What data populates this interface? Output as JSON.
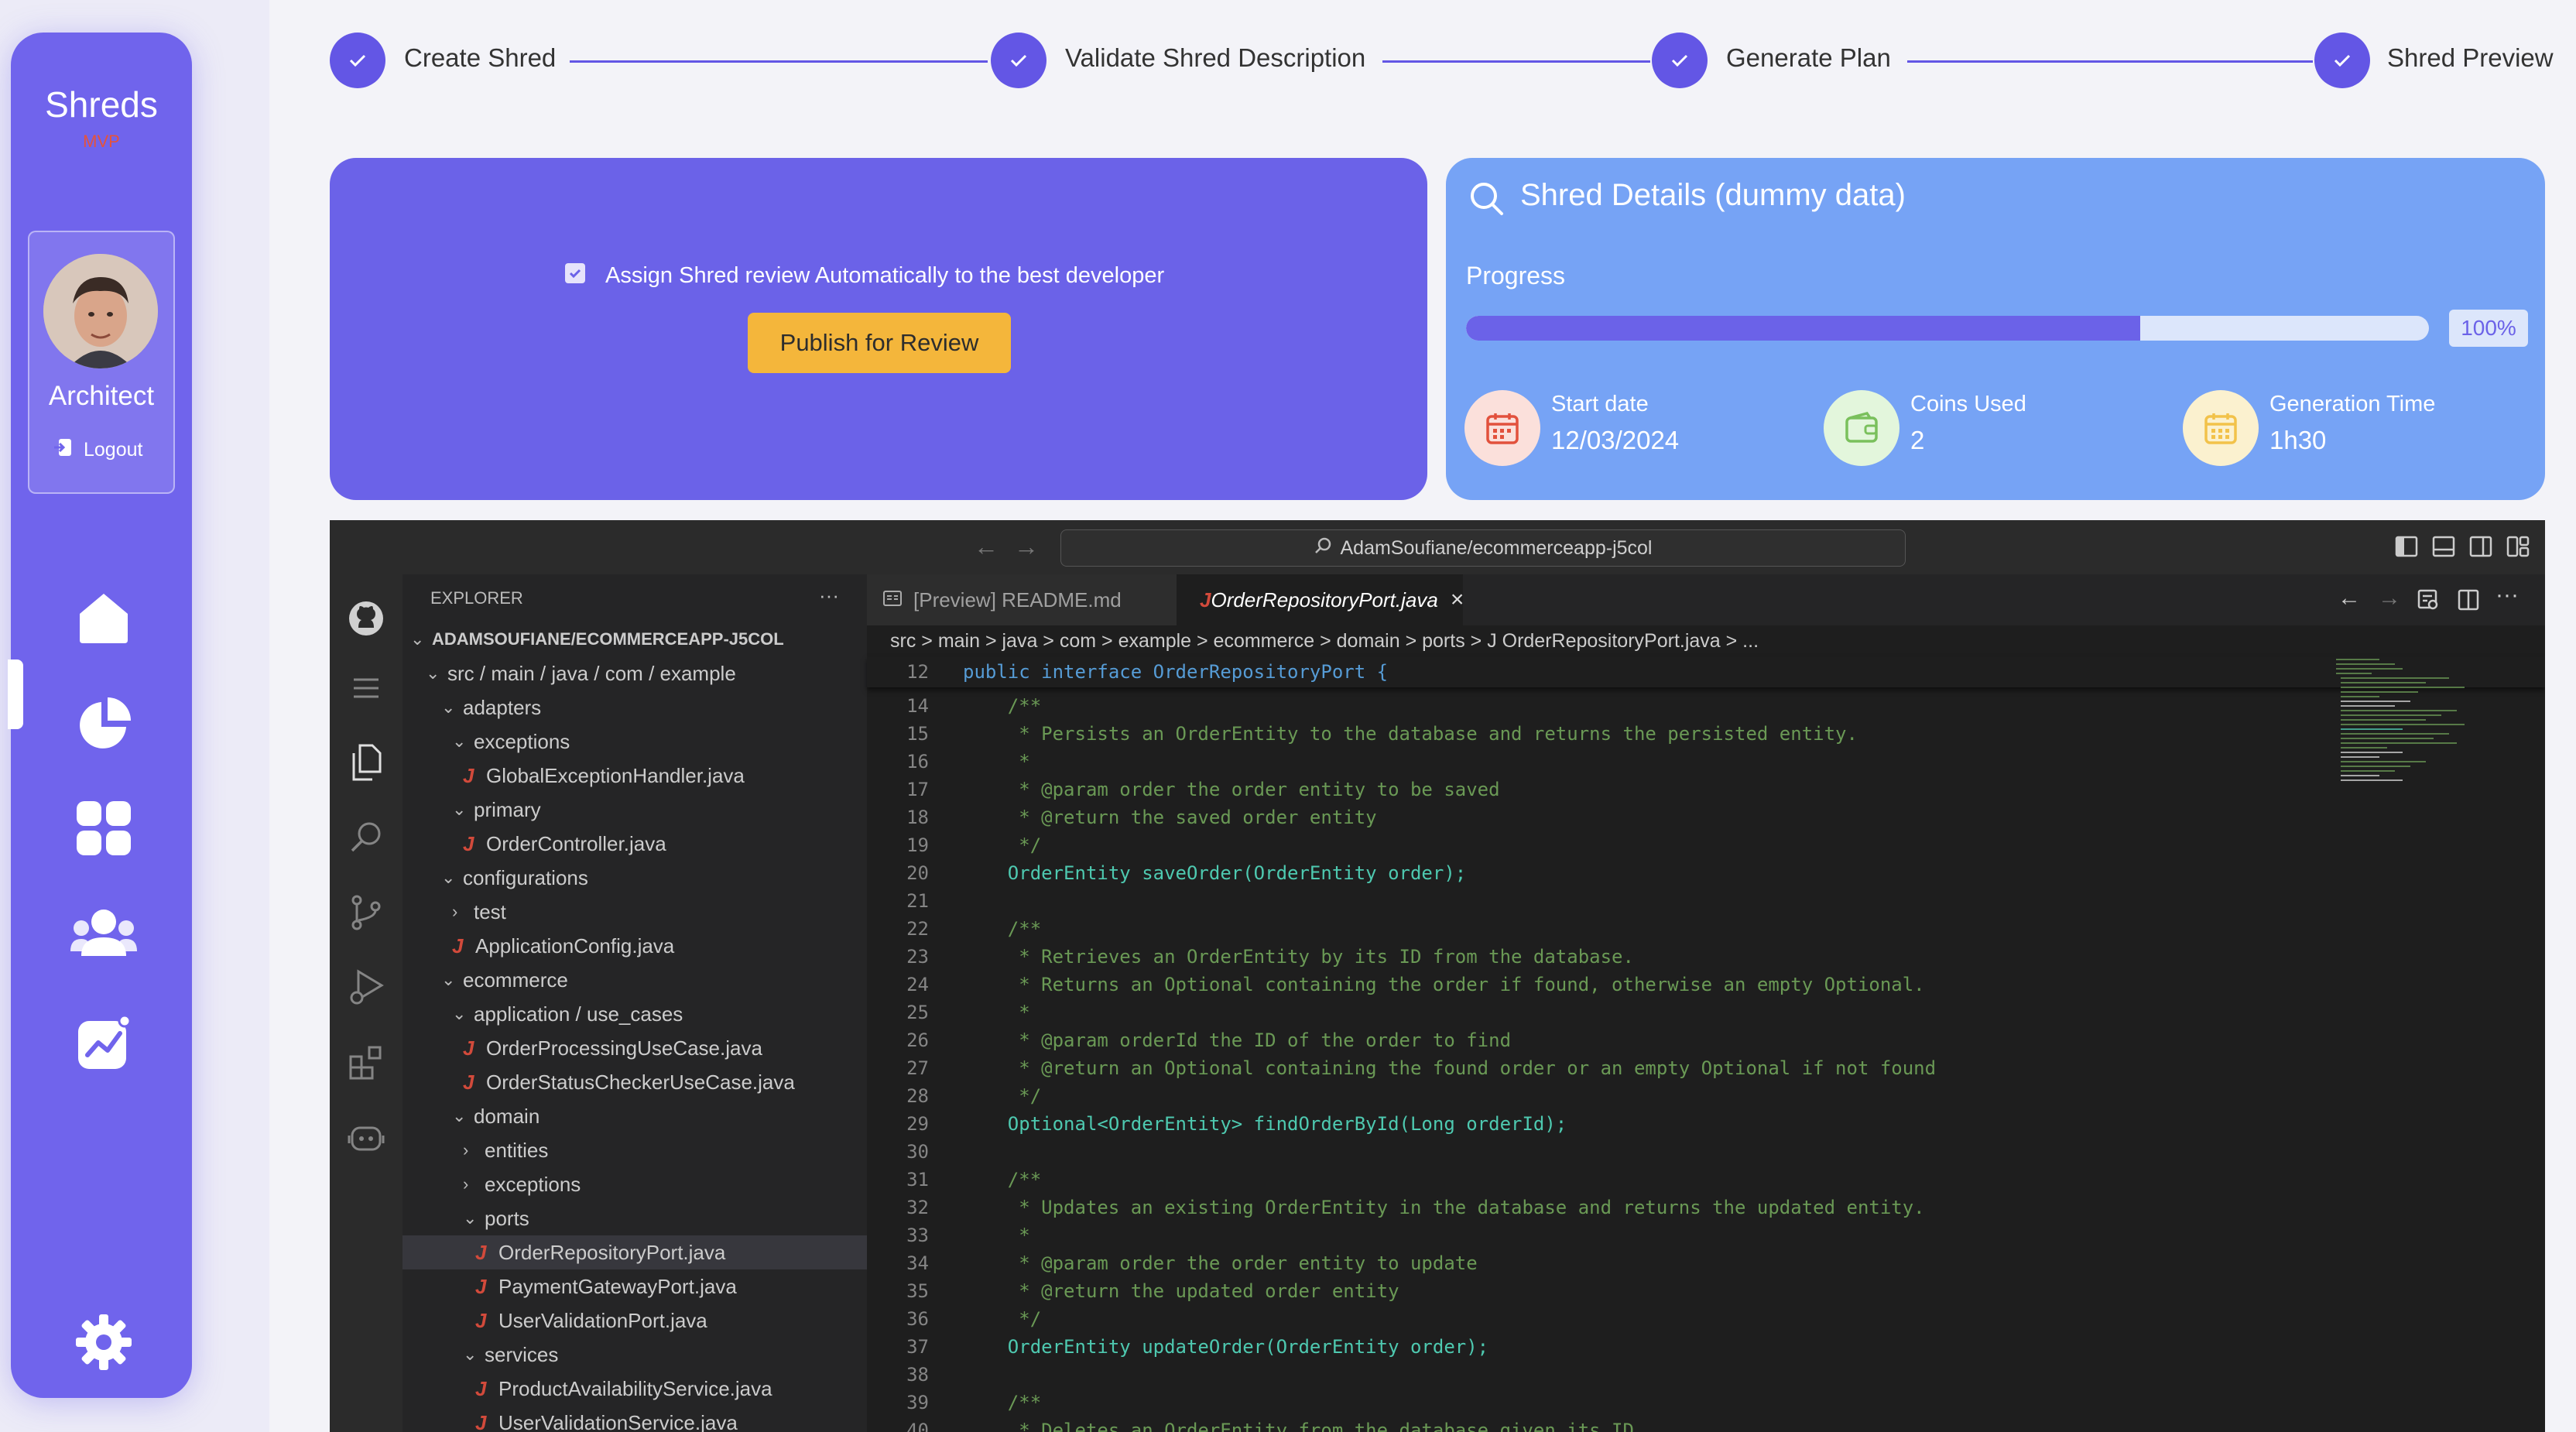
{
  "sidebar": {
    "brand": "Shreds",
    "brand_sub": "MVP",
    "role": "Architect",
    "logout_label": "Logout",
    "nav": [
      "home-icon",
      "pie-chart-icon",
      "apps-grid-icon",
      "users-icon",
      "analytics-icon",
      "settings-icon"
    ]
  },
  "stepper": {
    "steps": [
      "Create Shred",
      "Validate Shred Description",
      "Generate Plan",
      "Shred Preview"
    ]
  },
  "publish": {
    "checkbox_label": "Assign Shred review Automatically to the best developer",
    "checked": true,
    "button_label": "Publish for Review"
  },
  "details": {
    "title": "Shred Details (dummy data)",
    "progress_label": "Progress",
    "progress_badge": "100%",
    "progress_fill_fraction": 0.7,
    "stats": [
      {
        "label": "Start date",
        "value": "12/03/2024",
        "icon": "calendar-icon"
      },
      {
        "label": "Coins Used",
        "value": "2",
        "icon": "wallet-icon"
      },
      {
        "label": "Generation Time",
        "value": "1h30",
        "icon": "calendar-clock-icon"
      }
    ]
  },
  "ide": {
    "address": "AdamSoufiane/ecommerceapp-j5col",
    "explorer_title": "EXPLORER",
    "explorer_more": "···",
    "tree": [
      {
        "label": "ADAMSOUFIANE/ECOMMERCEAPP-J5COL",
        "kind": "root",
        "indent": 0
      },
      {
        "label": "src / main / java / com / example",
        "kind": "folder-open",
        "indent": 1
      },
      {
        "label": "adapters",
        "kind": "folder-open",
        "indent": 2
      },
      {
        "label": "exceptions",
        "kind": "folder-open",
        "indent": 3
      },
      {
        "label": "GlobalExceptionHandler.java",
        "kind": "java",
        "indent": 4
      },
      {
        "label": "primary",
        "kind": "folder-open",
        "indent": 3
      },
      {
        "label": "OrderController.java",
        "kind": "java",
        "indent": 4
      },
      {
        "label": "configurations",
        "kind": "folder-open",
        "indent": 2
      },
      {
        "label": "test",
        "kind": "folder-closed",
        "indent": 3
      },
      {
        "label": "ApplicationConfig.java",
        "kind": "java",
        "indent": 3
      },
      {
        "label": "ecommerce",
        "kind": "folder-open",
        "indent": 2
      },
      {
        "label": "application / use_cases",
        "kind": "folder-open",
        "indent": 3
      },
      {
        "label": "OrderProcessingUseCase.java",
        "kind": "java",
        "indent": 4
      },
      {
        "label": "OrderStatusCheckerUseCase.java",
        "kind": "java",
        "indent": 4
      },
      {
        "label": "domain",
        "kind": "folder-open",
        "indent": 3
      },
      {
        "label": "entities",
        "kind": "folder-closed",
        "indent": 4
      },
      {
        "label": "exceptions",
        "kind": "folder-closed",
        "indent": 4
      },
      {
        "label": "ports",
        "kind": "folder-open",
        "indent": 4
      },
      {
        "label": "OrderRepositoryPort.java",
        "kind": "java",
        "indent": 5,
        "selected": true
      },
      {
        "label": "PaymentGatewayPort.java",
        "kind": "java",
        "indent": 5
      },
      {
        "label": "UserValidationPort.java",
        "kind": "java",
        "indent": 5
      },
      {
        "label": "services",
        "kind": "folder-open",
        "indent": 4
      },
      {
        "label": "ProductAvailabilityService.java",
        "kind": "java",
        "indent": 5
      },
      {
        "label": "UserValidationService.java",
        "kind": "java",
        "indent": 5
      }
    ],
    "tabs": [
      {
        "label": "[Preview] README.md",
        "active": false
      },
      {
        "label": "OrderRepositoryPort.java",
        "active": true
      }
    ],
    "breadcrumb": "src  >  main  >  java  >  com  >  example  >  ecommerce  >  domain  >  ports  >  J  OrderRepositoryPort.java  >  ...",
    "sticky_line": {
      "n": "12",
      "text": "public interface OrderRepositoryPort {"
    },
    "code": [
      {
        "n": "14",
        "t": "    /**",
        "c": "cm"
      },
      {
        "n": "15",
        "t": "     * Persists an OrderEntity to the database and returns the persisted entity.",
        "c": "cm"
      },
      {
        "n": "16",
        "t": "     *",
        "c": "cm"
      },
      {
        "n": "17",
        "t": "     * @param order the order entity to be saved",
        "c": "cm"
      },
      {
        "n": "18",
        "t": "     * @return the saved order entity",
        "c": "cm"
      },
      {
        "n": "19",
        "t": "     */",
        "c": "cm"
      },
      {
        "n": "20",
        "t": "    OrderEntity saveOrder(OrderEntity order);",
        "c": "code"
      },
      {
        "n": "21",
        "t": "",
        "c": "pl"
      },
      {
        "n": "22",
        "t": "    /**",
        "c": "cm"
      },
      {
        "n": "23",
        "t": "     * Retrieves an OrderEntity by its ID from the database.",
        "c": "cm"
      },
      {
        "n": "24",
        "t": "     * Returns an Optional containing the order if found, otherwise an empty Optional.",
        "c": "cm"
      },
      {
        "n": "25",
        "t": "     *",
        "c": "cm"
      },
      {
        "n": "26",
        "t": "     * @param orderId the ID of the order to find",
        "c": "cm"
      },
      {
        "n": "27",
        "t": "     * @return an Optional containing the found order or an empty Optional if not found",
        "c": "cm"
      },
      {
        "n": "28",
        "t": "     */",
        "c": "cm"
      },
      {
        "n": "29",
        "t": "    Optional<OrderEntity> findOrderById(Long orderId);",
        "c": "code"
      },
      {
        "n": "30",
        "t": "",
        "c": "pl"
      },
      {
        "n": "31",
        "t": "    /**",
        "c": "cm"
      },
      {
        "n": "32",
        "t": "     * Updates an existing OrderEntity in the database and returns the updated entity.",
        "c": "cm"
      },
      {
        "n": "33",
        "t": "     *",
        "c": "cm"
      },
      {
        "n": "34",
        "t": "     * @param order the order entity to update",
        "c": "cm"
      },
      {
        "n": "35",
        "t": "     * @return the updated order entity",
        "c": "cm"
      },
      {
        "n": "36",
        "t": "     */",
        "c": "cm"
      },
      {
        "n": "37",
        "t": "    OrderEntity updateOrder(OrderEntity order);",
        "c": "code"
      },
      {
        "n": "38",
        "t": "",
        "c": "pl"
      },
      {
        "n": "39",
        "t": "    /**",
        "c": "cm"
      },
      {
        "n": "40",
        "t": "     * Deletes an OrderEntity from the database given its ID",
        "c": "cm"
      }
    ]
  },
  "colors": {
    "accent": "#6b62e8",
    "details_bg": "#76a3f5",
    "publish_btn": "#f4b63b",
    "editor_bg": "#1e1e1e"
  }
}
